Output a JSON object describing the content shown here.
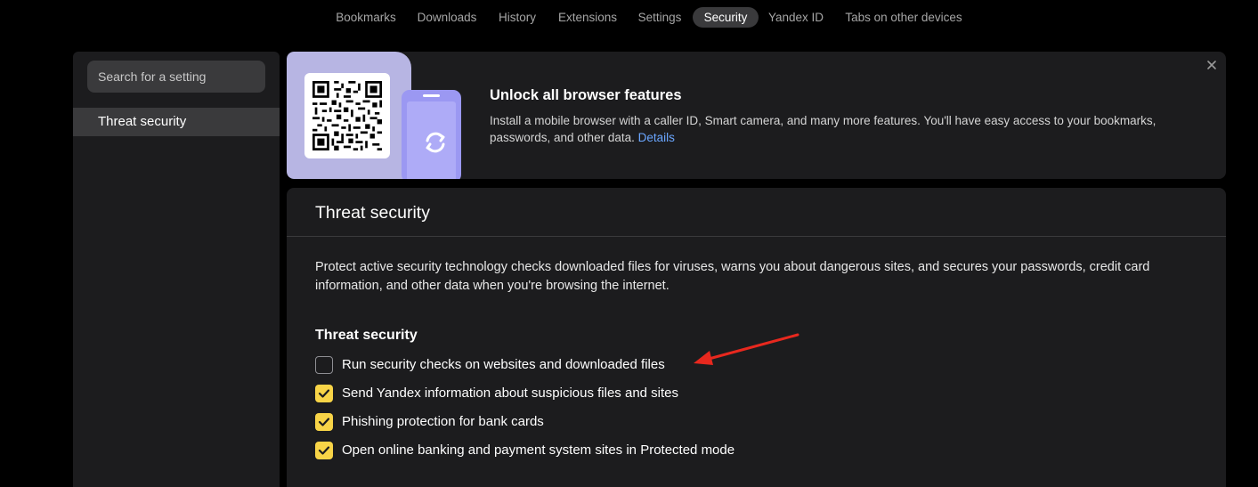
{
  "topnav": {
    "items": [
      {
        "label": "Bookmarks"
      },
      {
        "label": "Downloads"
      },
      {
        "label": "History"
      },
      {
        "label": "Extensions"
      },
      {
        "label": "Settings"
      },
      {
        "label": "Security"
      },
      {
        "label": "Yandex ID"
      },
      {
        "label": "Tabs on other devices"
      }
    ],
    "active": "Security"
  },
  "sidebar": {
    "search_placeholder": "Search for a setting",
    "items": [
      {
        "label": "Threat security",
        "selected": true
      }
    ]
  },
  "banner": {
    "title": "Unlock all browser features",
    "text": "Install a mobile browser with a caller ID, Smart camera, and many more features. You'll have easy access to your bookmarks, passwords, and other data.",
    "link": "Details",
    "icons": [
      "qr-code-icon",
      "phone-icon",
      "sync-icon",
      "close-icon"
    ],
    "accent_color": "#b7b5e3",
    "link_color": "#6aa6ff"
  },
  "main": {
    "title": "Threat security",
    "description": "Protect active security technology checks downloaded files for viruses, warns you about dangerous sites, and secures your passwords, credit card information, and other data when you're browsing the internet.",
    "section_title": "Threat security",
    "options": [
      {
        "label": "Run security checks on websites and downloaded files",
        "checked": false
      },
      {
        "label": "Send Yandex information about suspicious files and sites",
        "checked": true
      },
      {
        "label": "Phishing protection for bank cards",
        "checked": true
      },
      {
        "label": "Open online banking and payment system sites in Protected mode",
        "checked": true
      }
    ],
    "checkbox_color": "#f8d447"
  },
  "annotation": {
    "icon": "red-arrow-icon",
    "color": "#e8281e"
  }
}
